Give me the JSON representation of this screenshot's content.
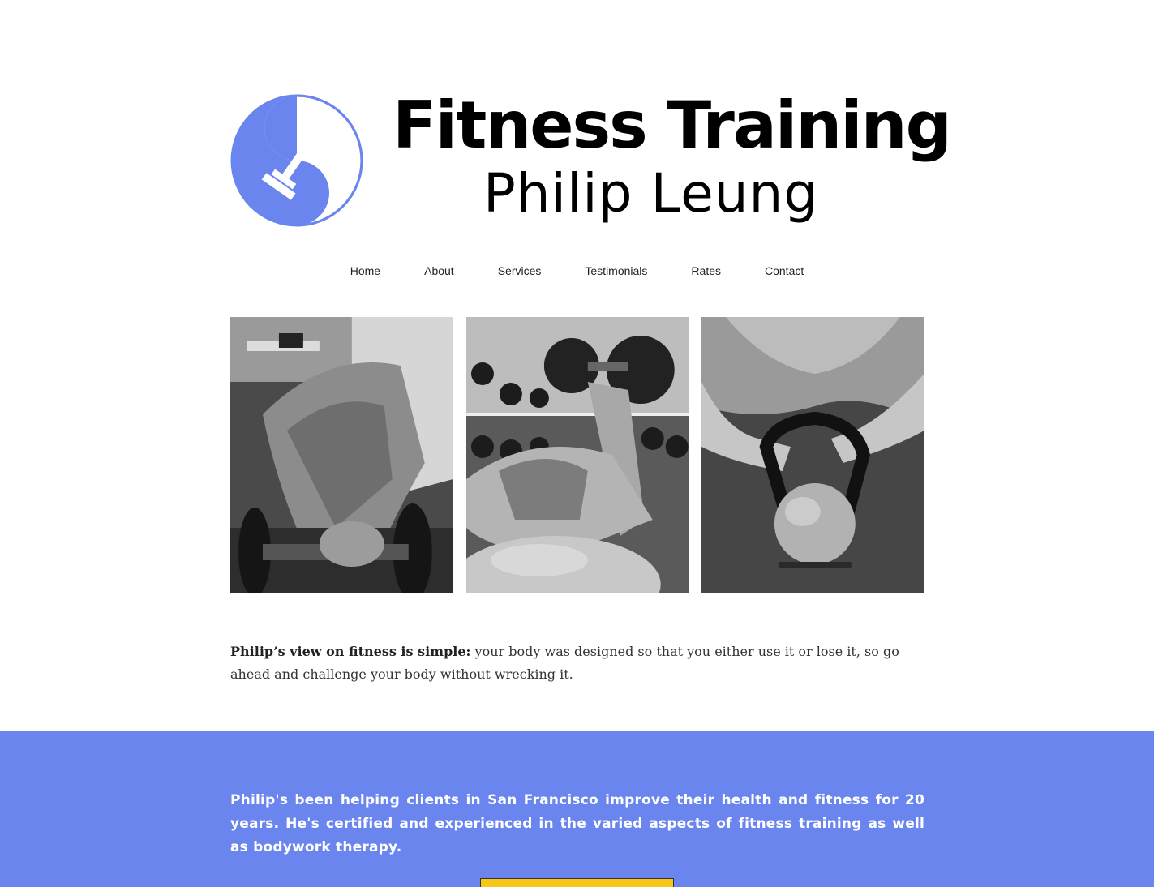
{
  "header": {
    "title": "Fitness Training",
    "subtitle": "Philip Leung",
    "logo_icon": "yin-yang-dumbbell-icon",
    "brand_color": "#6b85ee"
  },
  "nav": {
    "items": [
      "Home",
      "About",
      "Services",
      "Testimonials",
      "Rates",
      "Contact"
    ]
  },
  "gallery": {
    "photos": [
      "dumbbell-raise-photo",
      "dumbbell-curl-on-ball-photo",
      "kettlebell-photo"
    ]
  },
  "intro": {
    "lead": "Philip’s view on fitness is simple:",
    "body": " your body was designed so that you either use it or lose it, so go ahead and challenge your body without wrecking it."
  },
  "band": {
    "text": "Philip's been helping clients in San Francisco improve their health and fitness for 20 years. He's certified and experienced in the varied aspects of fitness training as well as bodywork therapy.",
    "background": "#6b85ee",
    "cta_color": "#f5c71a"
  }
}
